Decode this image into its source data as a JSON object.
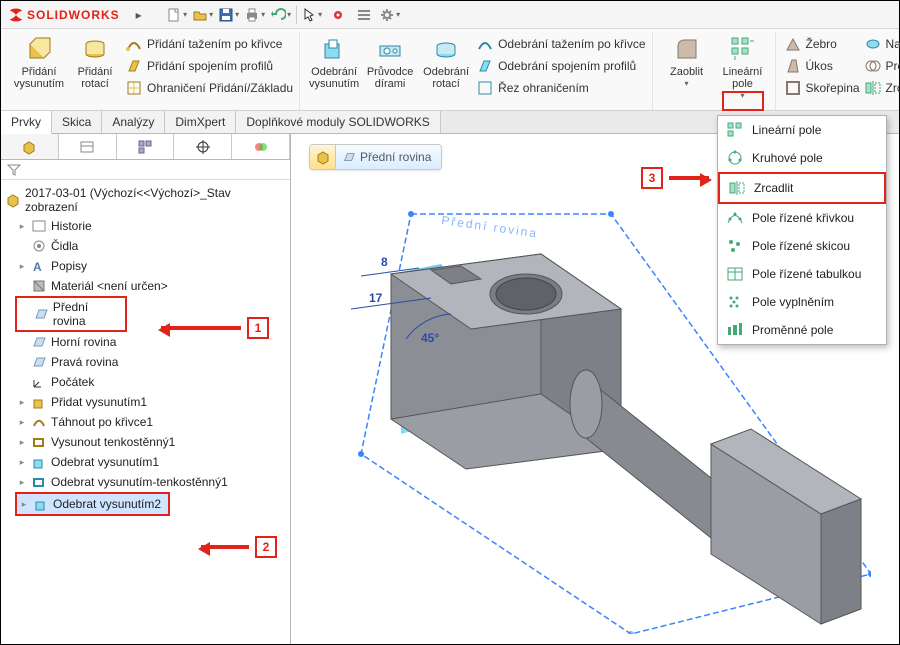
{
  "app": {
    "title": "SOLIDWORKS"
  },
  "ribbon": {
    "pridani_vysunutim": "Přidání\nvysunutím",
    "pridani_rotaci": "Přidání\nrotací",
    "pridani_tazenim": "Přidání tažením po křivce",
    "pridani_spojenim": "Přidání spojením profilů",
    "ohraniceni_pridani": "Ohraničení Přidání/Základu",
    "odebrani_vysunutim": "Odebrání\nvysunutím",
    "pruvodce_dirami": "Průvodce\ndírami",
    "odebrani_rotaci": "Odebrání\nrotací",
    "odebrani_tazenim": "Odebrání tažením po křivce",
    "odebrani_spojenim": "Odebrání spojením profilů",
    "rez_ohr": "Řez ohraničením",
    "zaoblit": "Zaoblit",
    "linearni_pole": "Lineární\npole",
    "zebro": "Žebro",
    "ukos": "Úkos",
    "skorepina": "Skořepina",
    "nabalit": "Nabalit",
    "protnout": "Protnout",
    "zrcadlit": "Zrcadlit"
  },
  "tabs": {
    "prvky": "Prvky",
    "skica": "Skica",
    "analyzy": "Analýzy",
    "dimxpert": "DimXpert",
    "doplnky": "Doplňkové moduly SOLIDWORKS"
  },
  "tree": {
    "root": "2017-03-01  (Výchozí<<Výchozí>_Stav zobrazení",
    "historie": "Historie",
    "cidla": "Čidla",
    "popisy": "Popisy",
    "material": "Materiál <není určen>",
    "predni": "Přední rovina",
    "horni": "Horní rovina",
    "prava": "Pravá rovina",
    "pocatek": "Počátek",
    "f1": "Přidat vysunutím1",
    "f2": "Táhnout po křivce1",
    "f3": "Vysunout tenkostěnný1",
    "f4": "Odebrat vysunutím1",
    "f5": "Odebrat vysunutím-tenkostěnný1",
    "f6": "Odebrat vysunutím2"
  },
  "breadcrumb": {
    "label": "Přední rovina"
  },
  "canvas": {
    "plane_label": "Přední rovina",
    "dim8": "8",
    "dim17": "17",
    "dim45": "45°"
  },
  "dropdown": {
    "items": [
      "Lineární pole",
      "Kruhové pole",
      "Zrcadlit",
      "Pole řízené křivkou",
      "Pole řízené skicou",
      "Pole řízené tabulkou",
      "Pole vyplněním",
      "Proměnné pole"
    ]
  },
  "callouts": {
    "c1": "1",
    "c2": "2",
    "c3": "3"
  }
}
